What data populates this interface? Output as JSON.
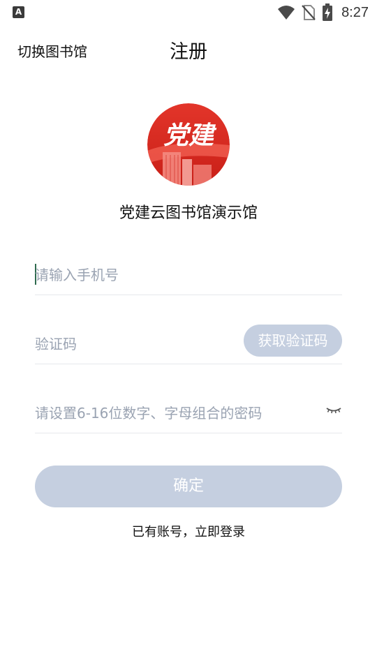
{
  "status_bar": {
    "left_icon": "A",
    "left_icon_name": "keyboard-a-icon",
    "icons": [
      "wifi-icon",
      "no-sim-icon",
      "battery-charging-icon"
    ],
    "time": "8:27"
  },
  "header": {
    "switch_label": "切换图书馆",
    "title": "注册"
  },
  "logo": {
    "text": "党建",
    "icon_name": "party-building-logo",
    "colors": {
      "primary": "#d8241d",
      "dark": "#b51812",
      "light": "#f06a5f"
    }
  },
  "library_name": "党建云图书馆演示馆",
  "form": {
    "phone_placeholder": "请输入手机号",
    "code_placeholder": "验证码",
    "get_code_label": "获取验证码",
    "password_placeholder": "请设置6-16位数字、字母组合的密码",
    "password_toggle_icon": "eye-closed-icon"
  },
  "confirm_label": "确定",
  "login_link": "已有账号，立即登录",
  "colors": {
    "button_disabled": "#c5cfe0",
    "placeholder": "#9aa3b2",
    "caret": "#2f6b4f",
    "divider": "#e6e8ec"
  }
}
